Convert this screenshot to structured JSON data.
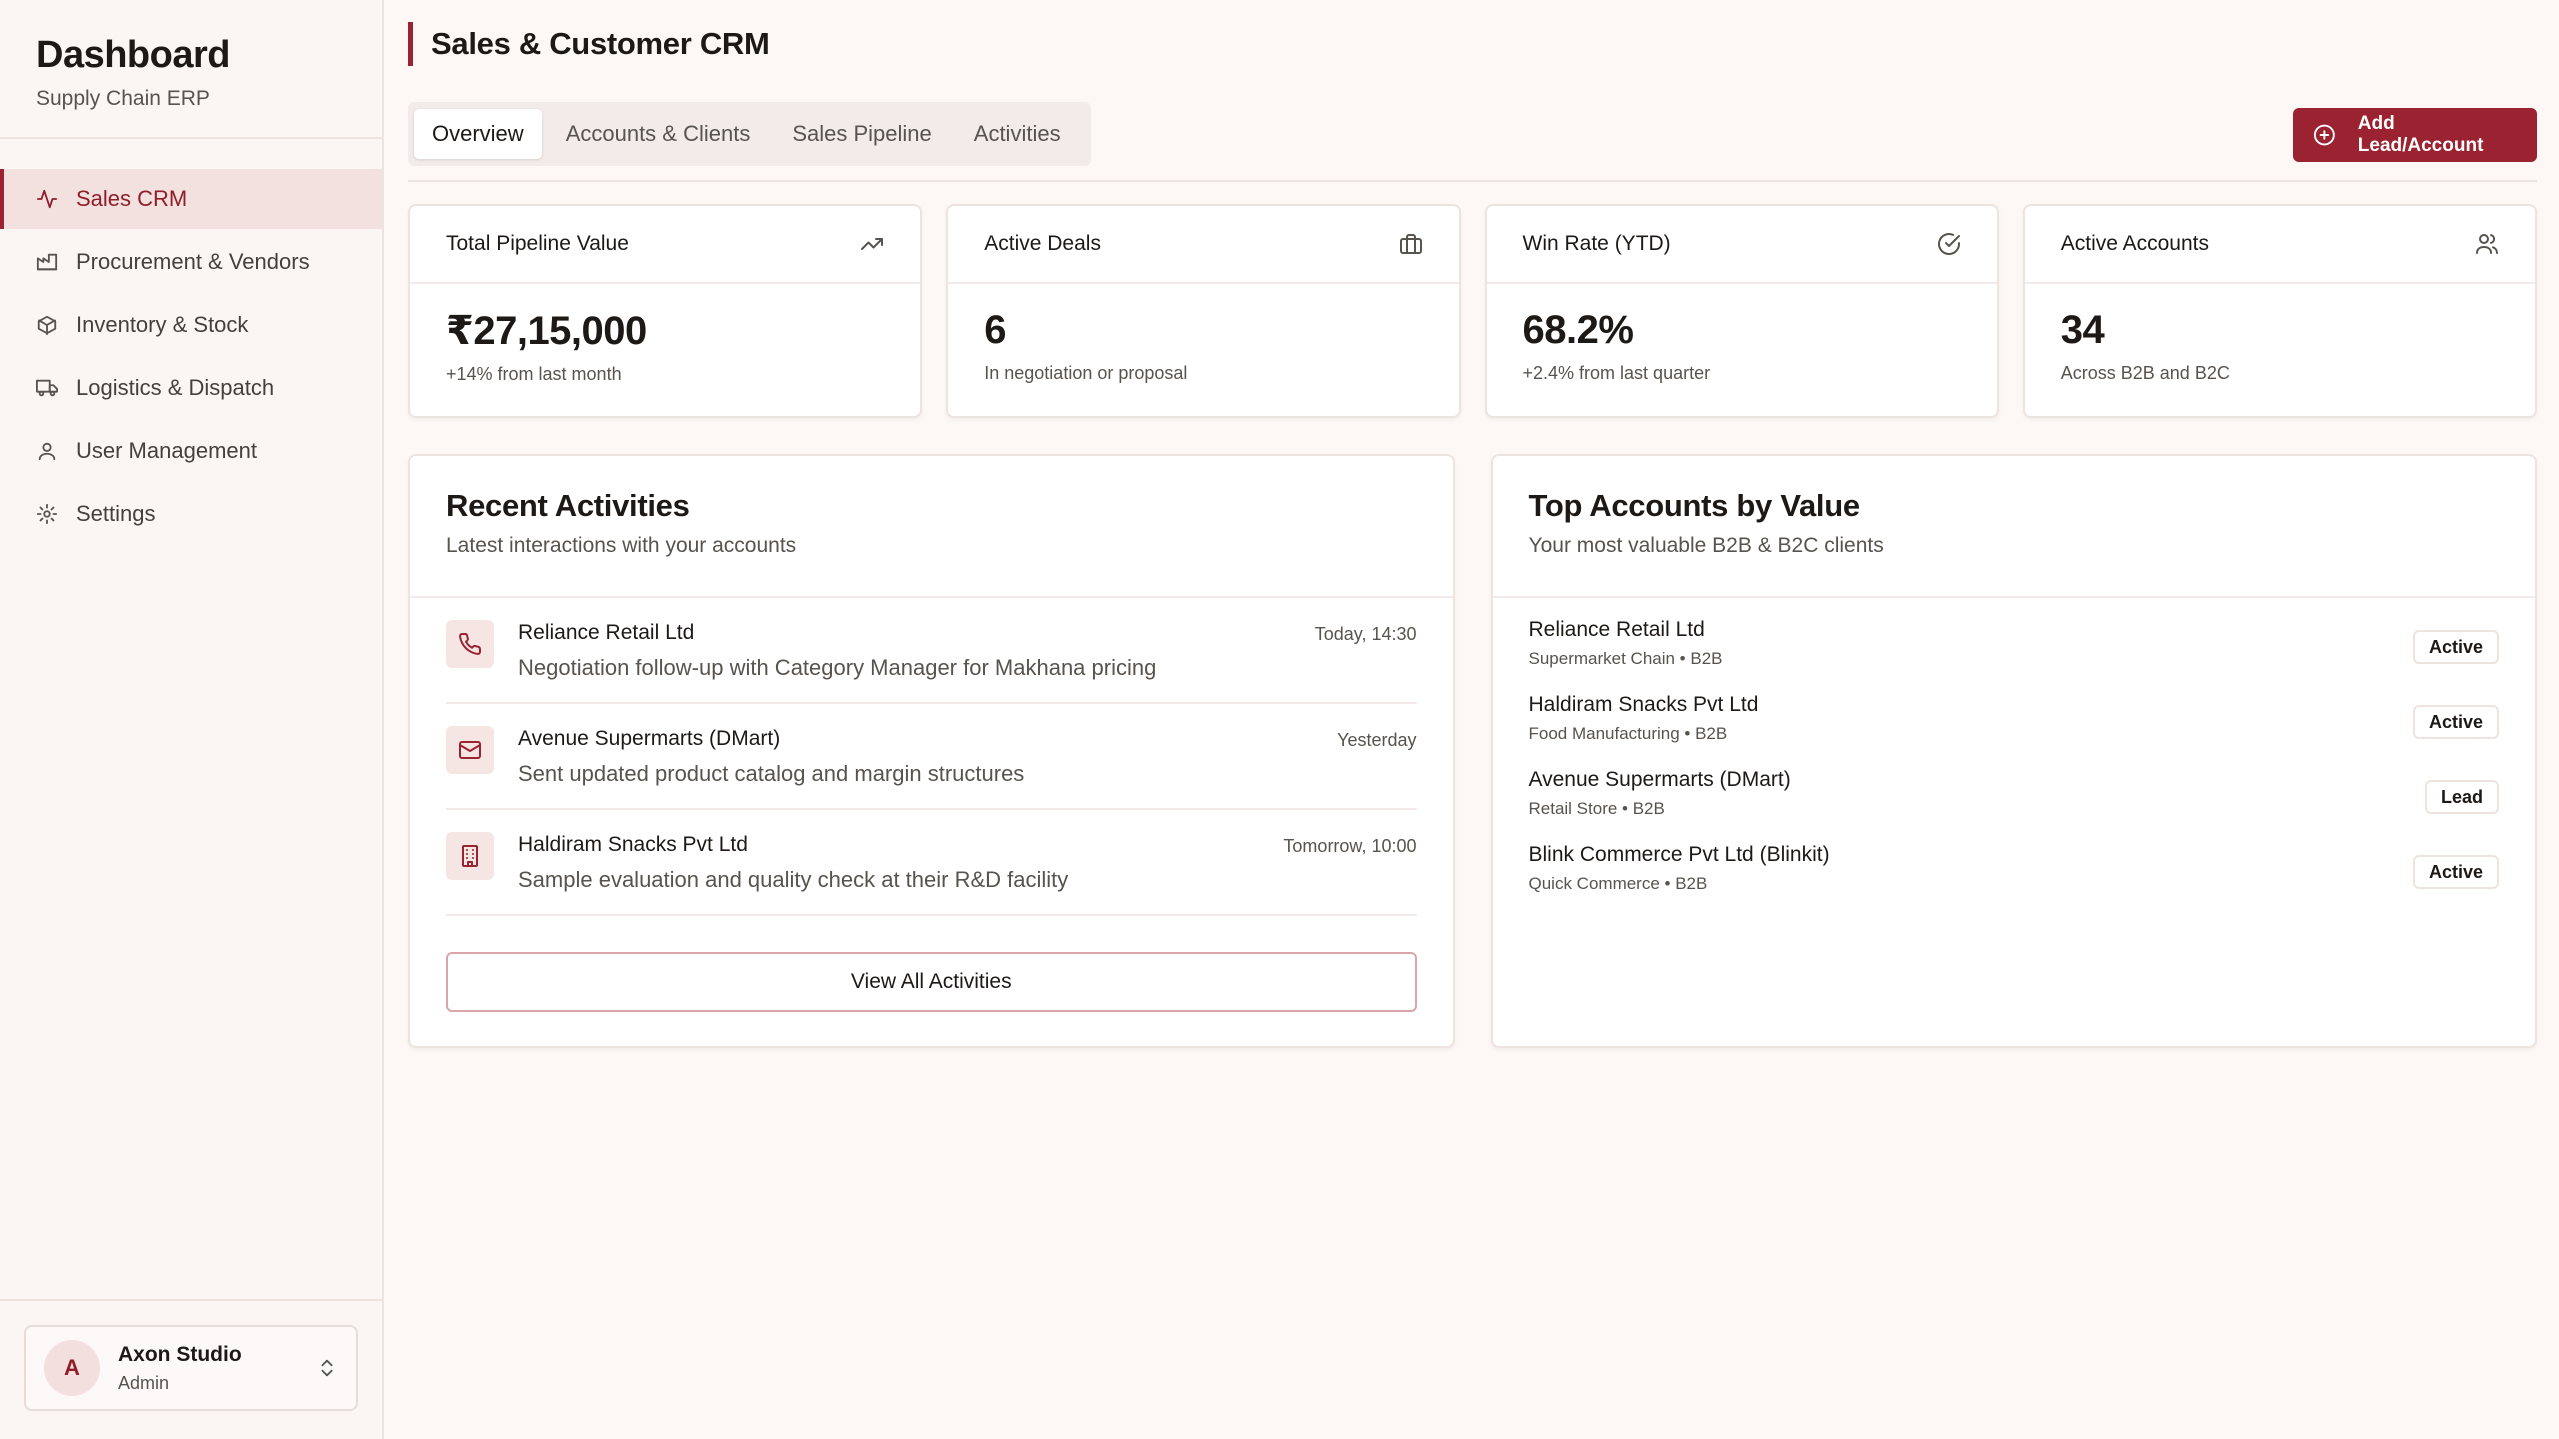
{
  "sidebar": {
    "title": "Dashboard",
    "subtitle": "Supply Chain ERP",
    "items": [
      {
        "label": "Sales CRM",
        "icon": "activity-icon",
        "active": true
      },
      {
        "label": "Procurement & Vendors",
        "icon": "factory-icon"
      },
      {
        "label": "Inventory & Stock",
        "icon": "package-icon"
      },
      {
        "label": "Logistics & Dispatch",
        "icon": "truck-icon"
      },
      {
        "label": "User Management",
        "icon": "user-icon"
      },
      {
        "label": "Settings",
        "icon": "gear-icon"
      }
    ],
    "user": {
      "initial": "A",
      "name": "Axon Studio",
      "role": "Admin"
    }
  },
  "header": {
    "title": "Sales & Customer CRM",
    "tabs": [
      "Overview",
      "Accounts & Clients",
      "Sales Pipeline",
      "Activities"
    ],
    "active_tab": "Overview",
    "add_button": "Add Lead/Account"
  },
  "kpis": [
    {
      "label": "Total Pipeline Value",
      "value": "₹27,15,000",
      "note": "+14% from last month",
      "icon": "trending-up-icon"
    },
    {
      "label": "Active Deals",
      "value": "6",
      "note": "In negotiation or proposal",
      "icon": "briefcase-icon"
    },
    {
      "label": "Win Rate (YTD)",
      "value": "68.2%",
      "note": "+2.4% from last quarter",
      "icon": "check-circle-icon"
    },
    {
      "label": "Active Accounts",
      "value": "34",
      "note": "Across B2B and B2C",
      "icon": "users-icon"
    }
  ],
  "activities": {
    "title": "Recent Activities",
    "subtitle": "Latest interactions with your accounts",
    "items": [
      {
        "name": "Reliance Retail Ltd",
        "desc": "Negotiation follow-up with Category Manager for Makhana pricing",
        "time": "Today, 14:30",
        "icon": "phone-icon"
      },
      {
        "name": "Avenue Supermarts (DMart)",
        "desc": "Sent updated product catalog and margin structures",
        "time": "Yesterday",
        "icon": "mail-icon"
      },
      {
        "name": "Haldiram Snacks Pvt Ltd",
        "desc": "Sample evaluation and quality check at their R&D facility",
        "time": "Tomorrow, 10:00",
        "icon": "building-icon"
      }
    ],
    "view_all": "View All Activities"
  },
  "accounts": {
    "title": "Top Accounts by Value",
    "subtitle": "Your most valuable B2B & B2C clients",
    "items": [
      {
        "name": "Reliance Retail Ltd",
        "meta": "Supermarket Chain • B2B",
        "status": "Active"
      },
      {
        "name": "Haldiram Snacks Pvt Ltd",
        "meta": "Food Manufacturing • B2B",
        "status": "Active"
      },
      {
        "name": "Avenue Supermarts (DMart)",
        "meta": "Retail Store • B2B",
        "status": "Lead"
      },
      {
        "name": "Blink Commerce Pvt Ltd (Blinkit)",
        "meta": "Quick Commerce • B2B",
        "status": "Active"
      }
    ]
  },
  "colors": {
    "accent": "#9b2230",
    "background": "#fdf8f6",
    "card": "#ffffff",
    "muted_text": "#57534e"
  }
}
